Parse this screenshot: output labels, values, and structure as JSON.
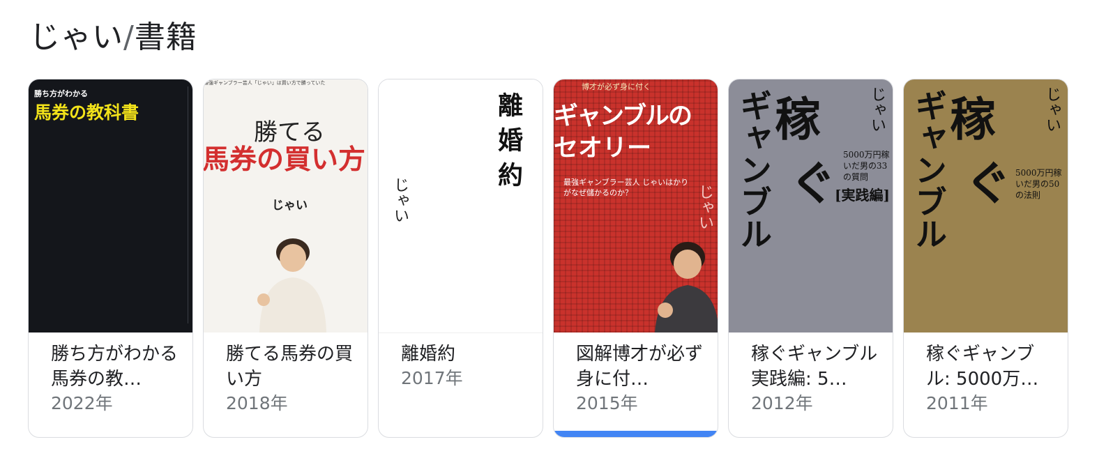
{
  "header": {
    "person": "じゃい",
    "separator": "/",
    "section": "書籍"
  },
  "accent": "#4285f4",
  "books": [
    {
      "title": "勝ち方がわかる馬券の教…",
      "year": "2022年",
      "cover": {
        "bg": "#14161b",
        "kicker": "勝ち方がわかる",
        "main": "馬券の教科書"
      }
    },
    {
      "title": "勝てる馬券の買い方",
      "year": "2018年",
      "cover": {
        "bg": "#f5f3ef",
        "top_line": "最強ギャンブラー芸人「じゃい」は買い方で勝っていた",
        "line1": "勝てる",
        "line2": "馬券の買い方",
        "author": "じゃい"
      }
    },
    {
      "title": "離婚約",
      "year": "2017年",
      "cover": {
        "bg": "#ffffff",
        "vertical_title": "離婚約",
        "author": "じゃい"
      }
    },
    {
      "title": "図解博才が必ず身に付…",
      "year": "2015年",
      "cover": {
        "bg": "#c9322c",
        "kicker": "博才が必ず身に付く",
        "main1": "ギャンブルの",
        "main2": "セオリー",
        "sub": "最強ギャンブラー芸人 じゃいはかりがなぜ儲かるのか？",
        "author": "じゃい"
      }
    },
    {
      "title": "稼ぐギャンブル実践編: 5…",
      "year": "2012年",
      "cover": {
        "bg": "#8c8d98",
        "kasegu": "稼",
        "gu": "ぐ",
        "gamble": "ギャンブル",
        "author": "じゃい",
        "note": "5000万円稼いだ男の33の質問",
        "tag": "[実践編]"
      }
    },
    {
      "title": "稼ぐギャンブル: 5000万…",
      "year": "2011年",
      "cover": {
        "bg": "#9b834f",
        "kasegu": "稼",
        "gu": "ぐ",
        "gamble": "ギャンブル",
        "author": "じゃい",
        "note": "5000万円稼いだ男の50の法則"
      }
    }
  ]
}
